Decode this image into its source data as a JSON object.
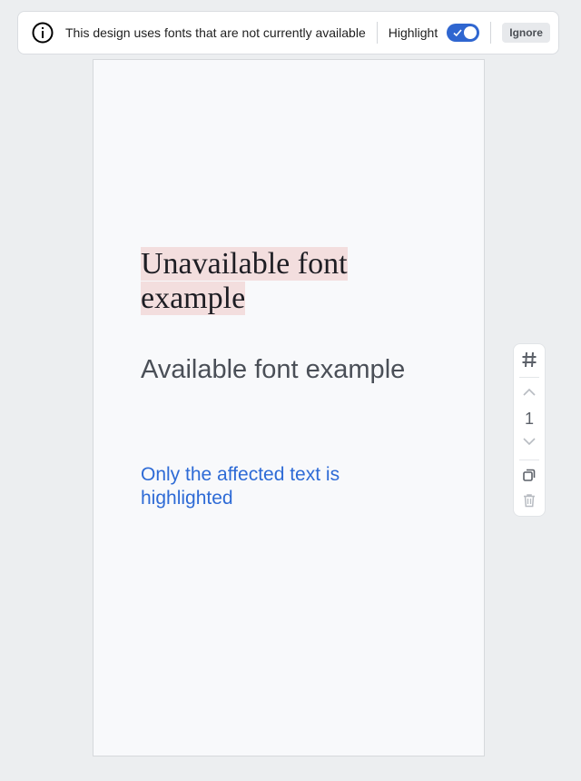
{
  "banner": {
    "icon": "info-icon",
    "message": "This design uses fonts that are not currently available",
    "highlight_label": "Highlight",
    "highlight_on": true,
    "ignore_label": "Ignore"
  },
  "page": {
    "unavailable_text": "Unavailable font example",
    "available_text": "Available font example",
    "note_text": "Only the affected text is highlighted"
  },
  "toolbar": {
    "icons": [
      "hash-icon",
      "chevron-up-icon",
      "chevron-down-icon",
      "duplicate-icon",
      "trash-icon"
    ],
    "page_number": "1"
  },
  "colors": {
    "accent": "#2f66d0",
    "highlight_bg": "#f3dede",
    "note_text": "#2e6bd6"
  }
}
